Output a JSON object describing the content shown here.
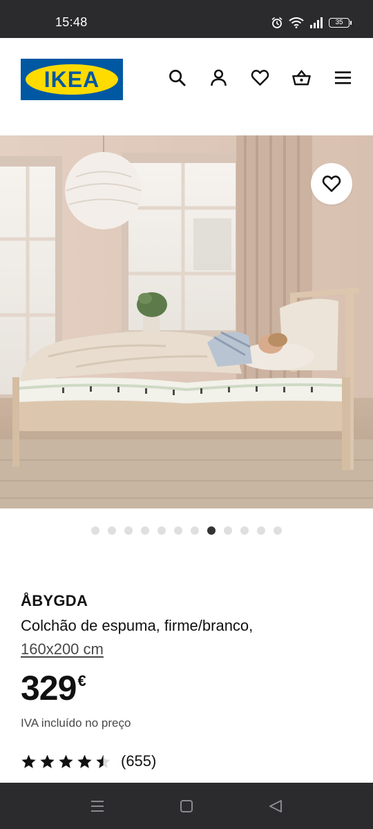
{
  "status_bar": {
    "time": "15:48",
    "battery": "35",
    "icons": [
      "alarm-icon",
      "wifi-icon",
      "signal-icon",
      "battery-icon"
    ]
  },
  "header": {
    "logo_text": "IKEA",
    "brand_colors": {
      "blue": "#0058a3",
      "yellow": "#ffdb00"
    },
    "icons": [
      "search-icon",
      "account-icon",
      "wishlist-icon",
      "cart-icon",
      "menu-icon"
    ]
  },
  "gallery": {
    "dot_count": 12,
    "active_index": 7,
    "favorite_icon": "heart-icon"
  },
  "product": {
    "name": "ÅBYGDA",
    "description": "Colchão de espuma, firme/branco,",
    "size": "160x200 cm",
    "price_integer": "329",
    "currency": "€",
    "vat_note": "IVA incluído no preço",
    "rating_value": 4.5,
    "rating_max": 5,
    "review_count": "(655)"
  },
  "nav_bar": {
    "buttons": [
      "recents-icon",
      "home-icon",
      "back-icon"
    ]
  }
}
